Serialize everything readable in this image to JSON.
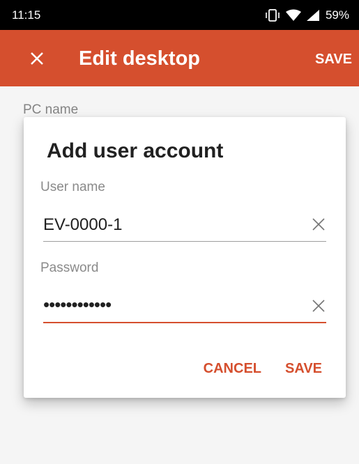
{
  "status_bar": {
    "time": "11:15",
    "battery": "59%",
    "icons": [
      "vibrate-icon",
      "wifi-icon",
      "signal-icon"
    ]
  },
  "app_bar": {
    "title": "Edit desktop",
    "save_label": "SAVE",
    "close_icon": "close-icon",
    "color": "#d54f2e"
  },
  "background_form": {
    "pc_name_label": "PC name"
  },
  "dialog": {
    "title": "Add user account",
    "username": {
      "label": "User name",
      "value": "EV-0000-1"
    },
    "password": {
      "label": "Password",
      "masked_value": "••••••••••••"
    },
    "cancel_label": "CANCEL",
    "save_label": "SAVE"
  }
}
